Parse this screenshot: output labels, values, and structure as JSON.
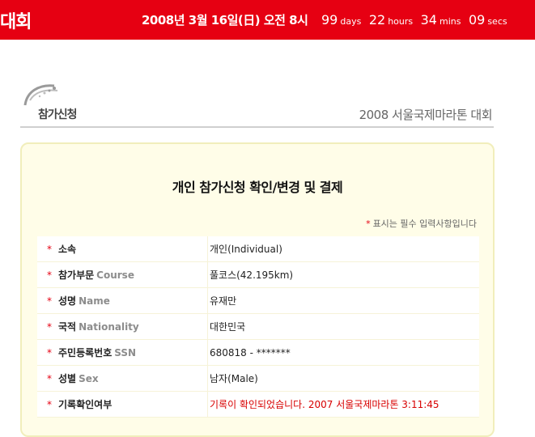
{
  "header": {
    "brand_fragment": "대회",
    "event_date": "2008년 3월 16일(日) 오전 8시",
    "countdown": [
      {
        "value": "99",
        "unit": "days"
      },
      {
        "value": "22",
        "unit": "hours"
      },
      {
        "value": "34",
        "unit": "mins"
      },
      {
        "value": "09",
        "unit": "secs"
      }
    ],
    "colors": {
      "bar": "#e60012",
      "text": "#ffffff"
    }
  },
  "section": {
    "icon": "runner-swoosh-icon",
    "label": "참가신청",
    "event_name": "2008 서울국제마라톤 대회"
  },
  "panel": {
    "title": "개인 참가신청 확인/변경 및 결제",
    "required_note": "표시는 필수 입력사항입니다",
    "required_mark": "*",
    "fields": [
      {
        "label": "소속",
        "label_en": "",
        "value": "개인(Individual)"
      },
      {
        "label": "참가부문",
        "label_en": "Course",
        "value": "풀코스(42.195km)"
      },
      {
        "label": "성명",
        "label_en": "Name",
        "value": "유재만"
      },
      {
        "label": "국적",
        "label_en": "Nationality",
        "value": "대한민국"
      },
      {
        "label": "주민등록번호",
        "label_en": "SSN",
        "value": "680818 - *******"
      },
      {
        "label": "성별",
        "label_en": "Sex",
        "value": "남자(Male)"
      },
      {
        "label": "기록확인여부",
        "label_en": "",
        "value": "기록이 확인되었습니다. 2007 서울국제마라톤 3:11:45"
      }
    ],
    "colors": {
      "panel_bg": "#fffde8",
      "panel_border": "#f1eebb",
      "required": "#e60012",
      "highlight_value": "#d80000"
    }
  }
}
